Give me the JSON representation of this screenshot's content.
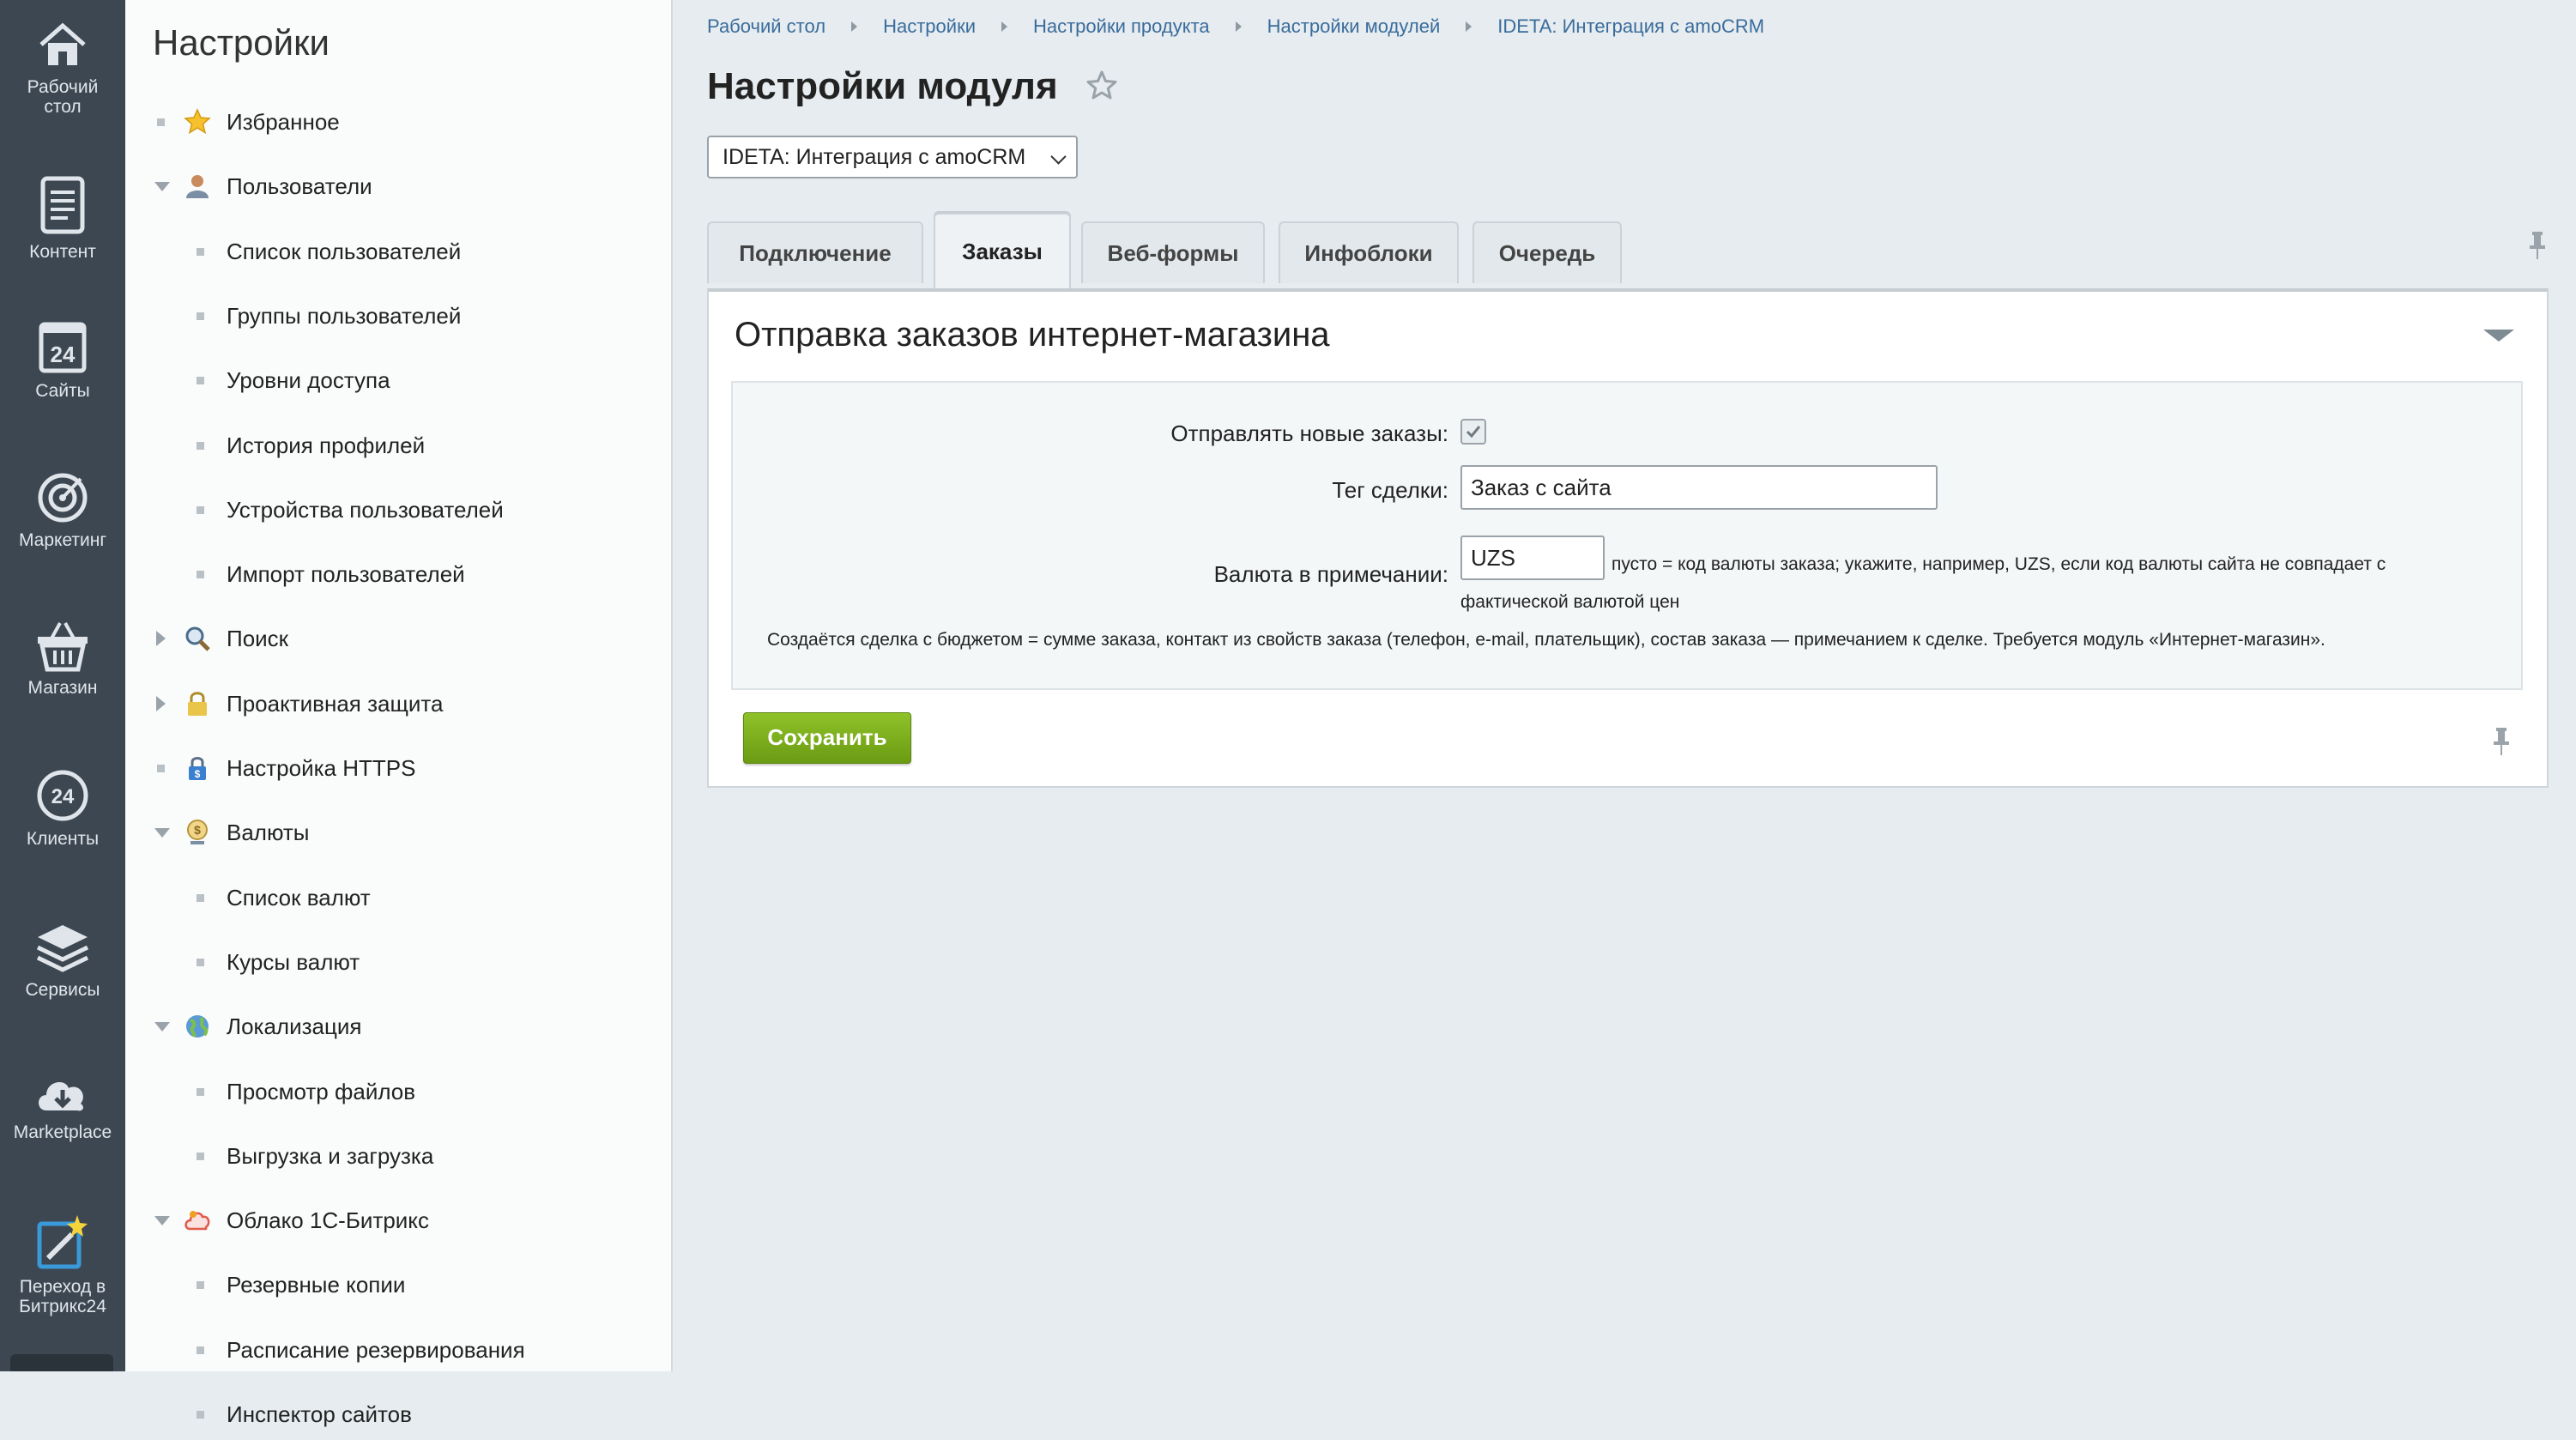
{
  "rail": {
    "items": [
      {
        "label": "Рабочий\nстол",
        "icon": "home-icon"
      },
      {
        "label": "Контент",
        "icon": "document-icon"
      },
      {
        "label": "Сайты",
        "icon": "calendar-24-icon"
      },
      {
        "label": "Маркетинг",
        "icon": "target-icon"
      },
      {
        "label": "Магазин",
        "icon": "basket-icon"
      },
      {
        "label": "Клиенты",
        "icon": "clients-24-icon"
      },
      {
        "label": "Сервисы",
        "icon": "layers-icon"
      },
      {
        "label": "Marketplace",
        "icon": "cloud-download-icon"
      },
      {
        "label": "Переход в\nБитрикс24",
        "icon": "magic-wand-icon"
      }
    ],
    "labels": {
      "desktop_1": "Рабочий",
      "desktop_2": "стол",
      "content": "Контент",
      "sites": "Сайты",
      "marketing": "Маркетинг",
      "shop": "Магазин",
      "clients": "Клиенты",
      "services": "Сервисы",
      "marketplace": "Marketplace",
      "b24_1": "Переход в",
      "b24_2": "Битрикс24"
    }
  },
  "tree": {
    "title": "Настройки",
    "items": [
      {
        "label": "Избранное",
        "marker": "dot",
        "icon": "star-icon"
      },
      {
        "label": "Пользователи",
        "marker": "expanded",
        "icon": "user-icon"
      },
      {
        "label": "Список пользователей",
        "marker": "dot"
      },
      {
        "label": "Группы пользователей",
        "marker": "dot"
      },
      {
        "label": "Уровни доступа",
        "marker": "dot"
      },
      {
        "label": "История профилей",
        "marker": "dot"
      },
      {
        "label": "Устройства пользователей",
        "marker": "dot"
      },
      {
        "label": "Импорт пользователей",
        "marker": "dot"
      },
      {
        "label": "Поиск",
        "marker": "collapsed",
        "icon": "magnifier-icon"
      },
      {
        "label": "Проактивная защита",
        "marker": "collapsed",
        "icon": "padlock-icon"
      },
      {
        "label": "Настройка HTTPS",
        "marker": "dot",
        "icon": "https-lock-icon"
      },
      {
        "label": "Валюты",
        "marker": "expanded",
        "icon": "currency-icon"
      },
      {
        "label": "Список валют",
        "marker": "dot"
      },
      {
        "label": "Курсы валют",
        "marker": "dot"
      },
      {
        "label": "Локализация",
        "marker": "expanded",
        "icon": "globe-icon"
      },
      {
        "label": "Просмотр файлов",
        "marker": "dot"
      },
      {
        "label": "Выгрузка и загрузка",
        "marker": "dot"
      },
      {
        "label": "Облако 1С-Битрикс",
        "marker": "expanded",
        "icon": "cloud-icon"
      },
      {
        "label": "Резервные копии",
        "marker": "dot"
      },
      {
        "label": "Расписание резервирования",
        "marker": "dot"
      },
      {
        "label": "Инспектор сайтов",
        "marker": "dot"
      }
    ]
  },
  "breadcrumb": [
    "Рабочий стол",
    "Настройки",
    "Настройки продукта",
    "Настройки модулей",
    "IDETA: Интеграция с amoCRM"
  ],
  "page": {
    "title": "Настройки модуля",
    "module_select": "IDETA: Интеграция с amoCRM"
  },
  "tabs": [
    "Подключение",
    "Заказы",
    "Веб-формы",
    "Инфоблоки",
    "Очередь"
  ],
  "active_tab": "Заказы",
  "section": {
    "title": "Отправка заказов интернет-магазина",
    "send_label": "Отправлять новые заказы:",
    "send_checked": true,
    "tag_label": "Тег сделки:",
    "tag_value": "Заказ с сайта",
    "currency_label": "Валюта в примечании:",
    "currency_value": "UZS",
    "currency_hint_1": "пусто = код валюты заказа; укажите, например, UZS, если код валюты сайта не совпадает с",
    "currency_hint_2": "фактической валютой цен",
    "description": "Создаётся сделка с бюджетом = сумме заказа, контакт из свойств заказа (телефон, e-mail, плательщик), состав заказа — примечанием к сделке. Требуется модуль «Интернет-магазин».",
    "save_label": "Сохранить"
  },
  "colors": {
    "rail_bg": "#3d4752",
    "link": "#3a6c9c",
    "save_button": "#7fae1d",
    "page_bg": "#e6ecef"
  }
}
